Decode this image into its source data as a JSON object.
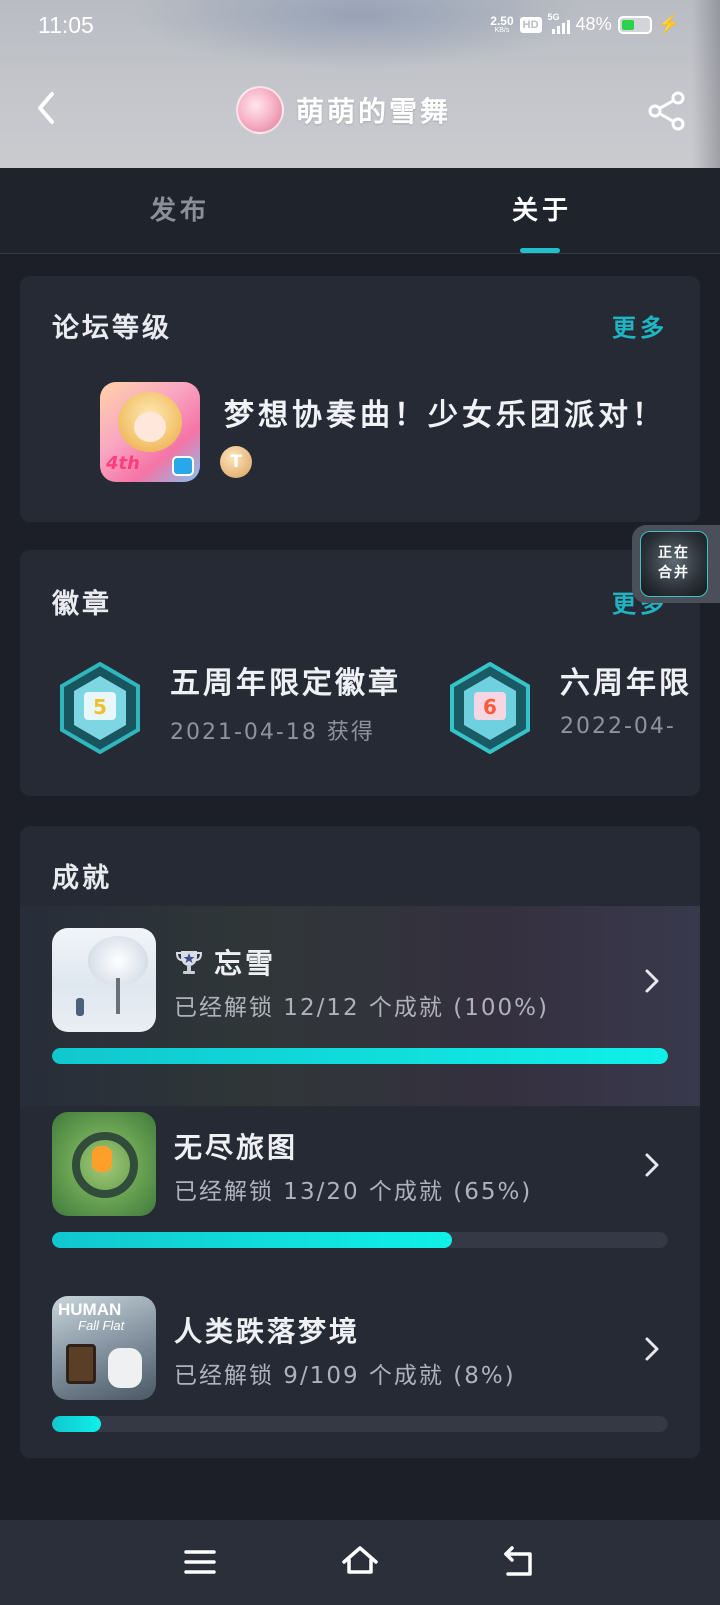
{
  "status_bar": {
    "time": "11:05",
    "net_speed": "2.50",
    "net_unit": "KB/s",
    "hd": "HD",
    "network": "5G",
    "battery_percent": "48%",
    "battery_level": 0.48
  },
  "header": {
    "title": "萌萌的雪舞"
  },
  "tabs": [
    {
      "label": "发布",
      "active": false
    },
    {
      "label": "关于",
      "active": true
    }
  ],
  "forum_level": {
    "title": "论坛等级",
    "more": "更多",
    "game_name": "梦想协奏曲！少女乐团派对！",
    "icon_text": "4th",
    "level_badge": "T"
  },
  "badges": {
    "title": "徽章",
    "more": "更多",
    "items": [
      {
        "name": "五周年限定徽章",
        "date": "2021-04-18 获得",
        "number": "5"
      },
      {
        "name": "六周年限",
        "date": "2022-04-",
        "number": "6"
      }
    ]
  },
  "merge_button": {
    "line1": "正在",
    "line2": "合并"
  },
  "achievements": {
    "title": "成就",
    "items": [
      {
        "name": "忘雪",
        "progress": "已经解锁 12/12 个成就 (100%)",
        "percent": 100,
        "trophy": true
      },
      {
        "name": "无尽旅图",
        "progress": "已经解锁 13/20 个成就 (65%)",
        "percent": 65,
        "trophy": false
      },
      {
        "name": "人类跌落梦境",
        "progress": "已经解锁 9/109 个成就 (8%)",
        "percent": 8,
        "trophy": false,
        "icon_line1": "HUMAN",
        "icon_line2": "Fall Flat"
      }
    ]
  },
  "colors": {
    "accent": "#1fb6c3",
    "progress": "#10f0e8",
    "card": "#262a35",
    "background": "#1c1f27"
  },
  "icons": {
    "back": "chevron-left-icon",
    "share": "share-icon",
    "nav_menu": "menu-icon",
    "nav_home": "home-icon",
    "nav_back": "back-icon"
  }
}
